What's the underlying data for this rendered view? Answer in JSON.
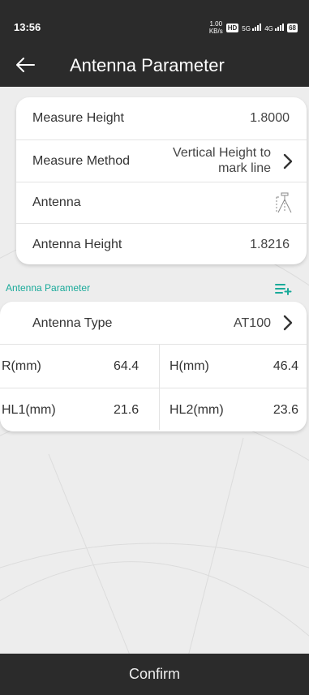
{
  "status_bar": {
    "time": "13:56",
    "net_speed_top": "1.00",
    "net_speed_bottom": "KB/s",
    "hd_badge": "HD",
    "net1": "5G",
    "net2": "4G",
    "battery": "68"
  },
  "header": {
    "title": "Antenna Parameter",
    "back_icon": "arrow-left-icon"
  },
  "measure_card": {
    "measure_height_label": "Measure Height",
    "measure_height_value": "1.8000",
    "measure_method_label": "Measure Method",
    "measure_method_value_line1": "Vertical Height to",
    "measure_method_value_line2": "mark line",
    "antenna_label": "Antenna",
    "antenna_icon": "antenna-tripod-icon",
    "antenna_height_label": "Antenna Height",
    "antenna_height_value": "1.8216"
  },
  "section": {
    "label": "Antenna Parameter",
    "add_icon": "list-add-icon"
  },
  "antenna_card": {
    "type_label": "Antenna Type",
    "type_value": "AT100",
    "r_label": "R(mm)",
    "r_value": "64.4",
    "h_label": "H(mm)",
    "h_value": "46.4",
    "hl1_label": "HL1(mm)",
    "hl1_value": "21.6",
    "hl2_label": "HL2(mm)",
    "hl2_value": "23.6"
  },
  "footer": {
    "confirm_label": "Confirm"
  },
  "colors": {
    "bar": "#2b2b2b",
    "accent": "#1aaa9a",
    "background": "#ededed"
  }
}
